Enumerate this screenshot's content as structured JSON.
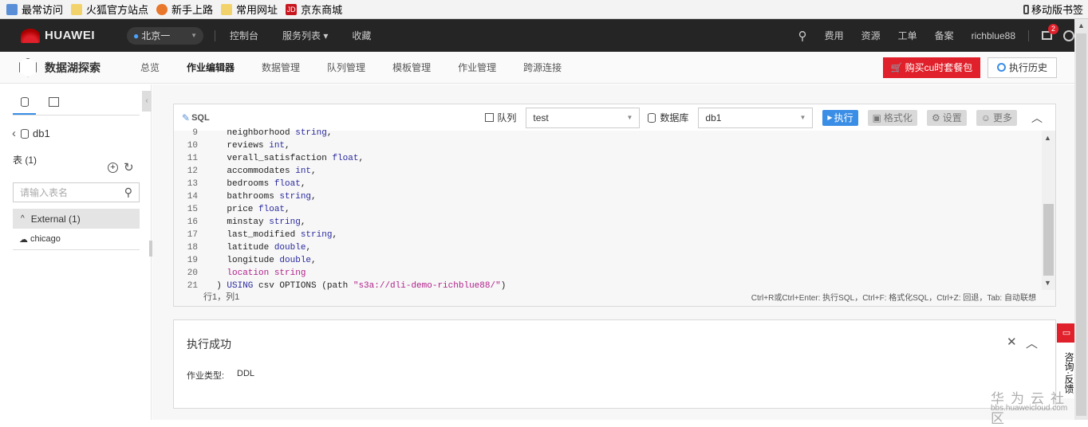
{
  "bookmarks": [
    "最常访问",
    "火狐官方站点",
    "新手上路",
    "常用网址",
    "京东商城"
  ],
  "mobile_bookmarks": "移动版书签",
  "header": {
    "brand": "HUAWEI",
    "region": "北京一",
    "nav": [
      "控制台",
      "服务列表 ▾",
      "收藏"
    ],
    "right": [
      "费用",
      "资源",
      "工单",
      "备案",
      "richblue88"
    ],
    "badge": "2"
  },
  "subnav": {
    "product": "数据湖探索",
    "tabs": [
      "总览",
      "作业编辑器",
      "数据管理",
      "队列管理",
      "模板管理",
      "作业管理",
      "跨源连接"
    ],
    "active": 1,
    "buy": "购买cu时套餐包",
    "history": "执行历史"
  },
  "sidebar": {
    "db": "db1",
    "tables_label": "表 (1)",
    "search_placeholder": "请输入表名",
    "group": "External (1)",
    "table": "chicago"
  },
  "editor": {
    "title": "SQL",
    "queue_label": "队列",
    "queue": "test",
    "db_label": "数据库",
    "db": "db1",
    "run": "执行",
    "format": "格式化",
    "settings": "设置",
    "more": "更多",
    "lines": [
      {
        "n": "9",
        "t": "    neighborhood ",
        "k": "string",
        "e": ","
      },
      {
        "n": "10",
        "t": "    reviews ",
        "k": "int",
        "e": ","
      },
      {
        "n": "11",
        "t": "    verall_satisfaction ",
        "k": "float",
        "e": ","
      },
      {
        "n": "12",
        "t": "    accommodates ",
        "k": "int",
        "e": ","
      },
      {
        "n": "13",
        "t": "    bedrooms ",
        "k": "float",
        "e": ","
      },
      {
        "n": "14",
        "t": "    bathrooms ",
        "k": "string",
        "e": ","
      },
      {
        "n": "15",
        "t": "    price ",
        "k": "float",
        "e": ","
      },
      {
        "n": "16",
        "t": "    minstay ",
        "k": "string",
        "e": ","
      },
      {
        "n": "17",
        "t": "    last_modified ",
        "k": "string",
        "e": ","
      },
      {
        "n": "18",
        "t": "    latitude ",
        "k": "double",
        "e": ","
      },
      {
        "n": "19",
        "t": "    longitude ",
        "k": "double",
        "e": ","
      },
      {
        "n": "20",
        "t": "    location string",
        "k": "",
        "e": ""
      },
      {
        "n": "21",
        "t": "  ) USING csv OPTIONS (path ",
        "k": "\"s3a://dli-demo-richblue88/\"",
        "e": ")"
      }
    ],
    "cursor": "行1，列1",
    "shortcuts": "Ctrl+R或Ctrl+Enter: 执行SQL，Ctrl+F: 格式化SQL，Ctrl+Z: 回退，Tab: 自动联想"
  },
  "result": {
    "title": "执行成功",
    "type_label": "作业类型:",
    "type": "DDL"
  },
  "feedback": "咨询·反馈",
  "watermark": {
    "title": "华为云社区",
    "url": "bbs.huaweicloud.com"
  }
}
